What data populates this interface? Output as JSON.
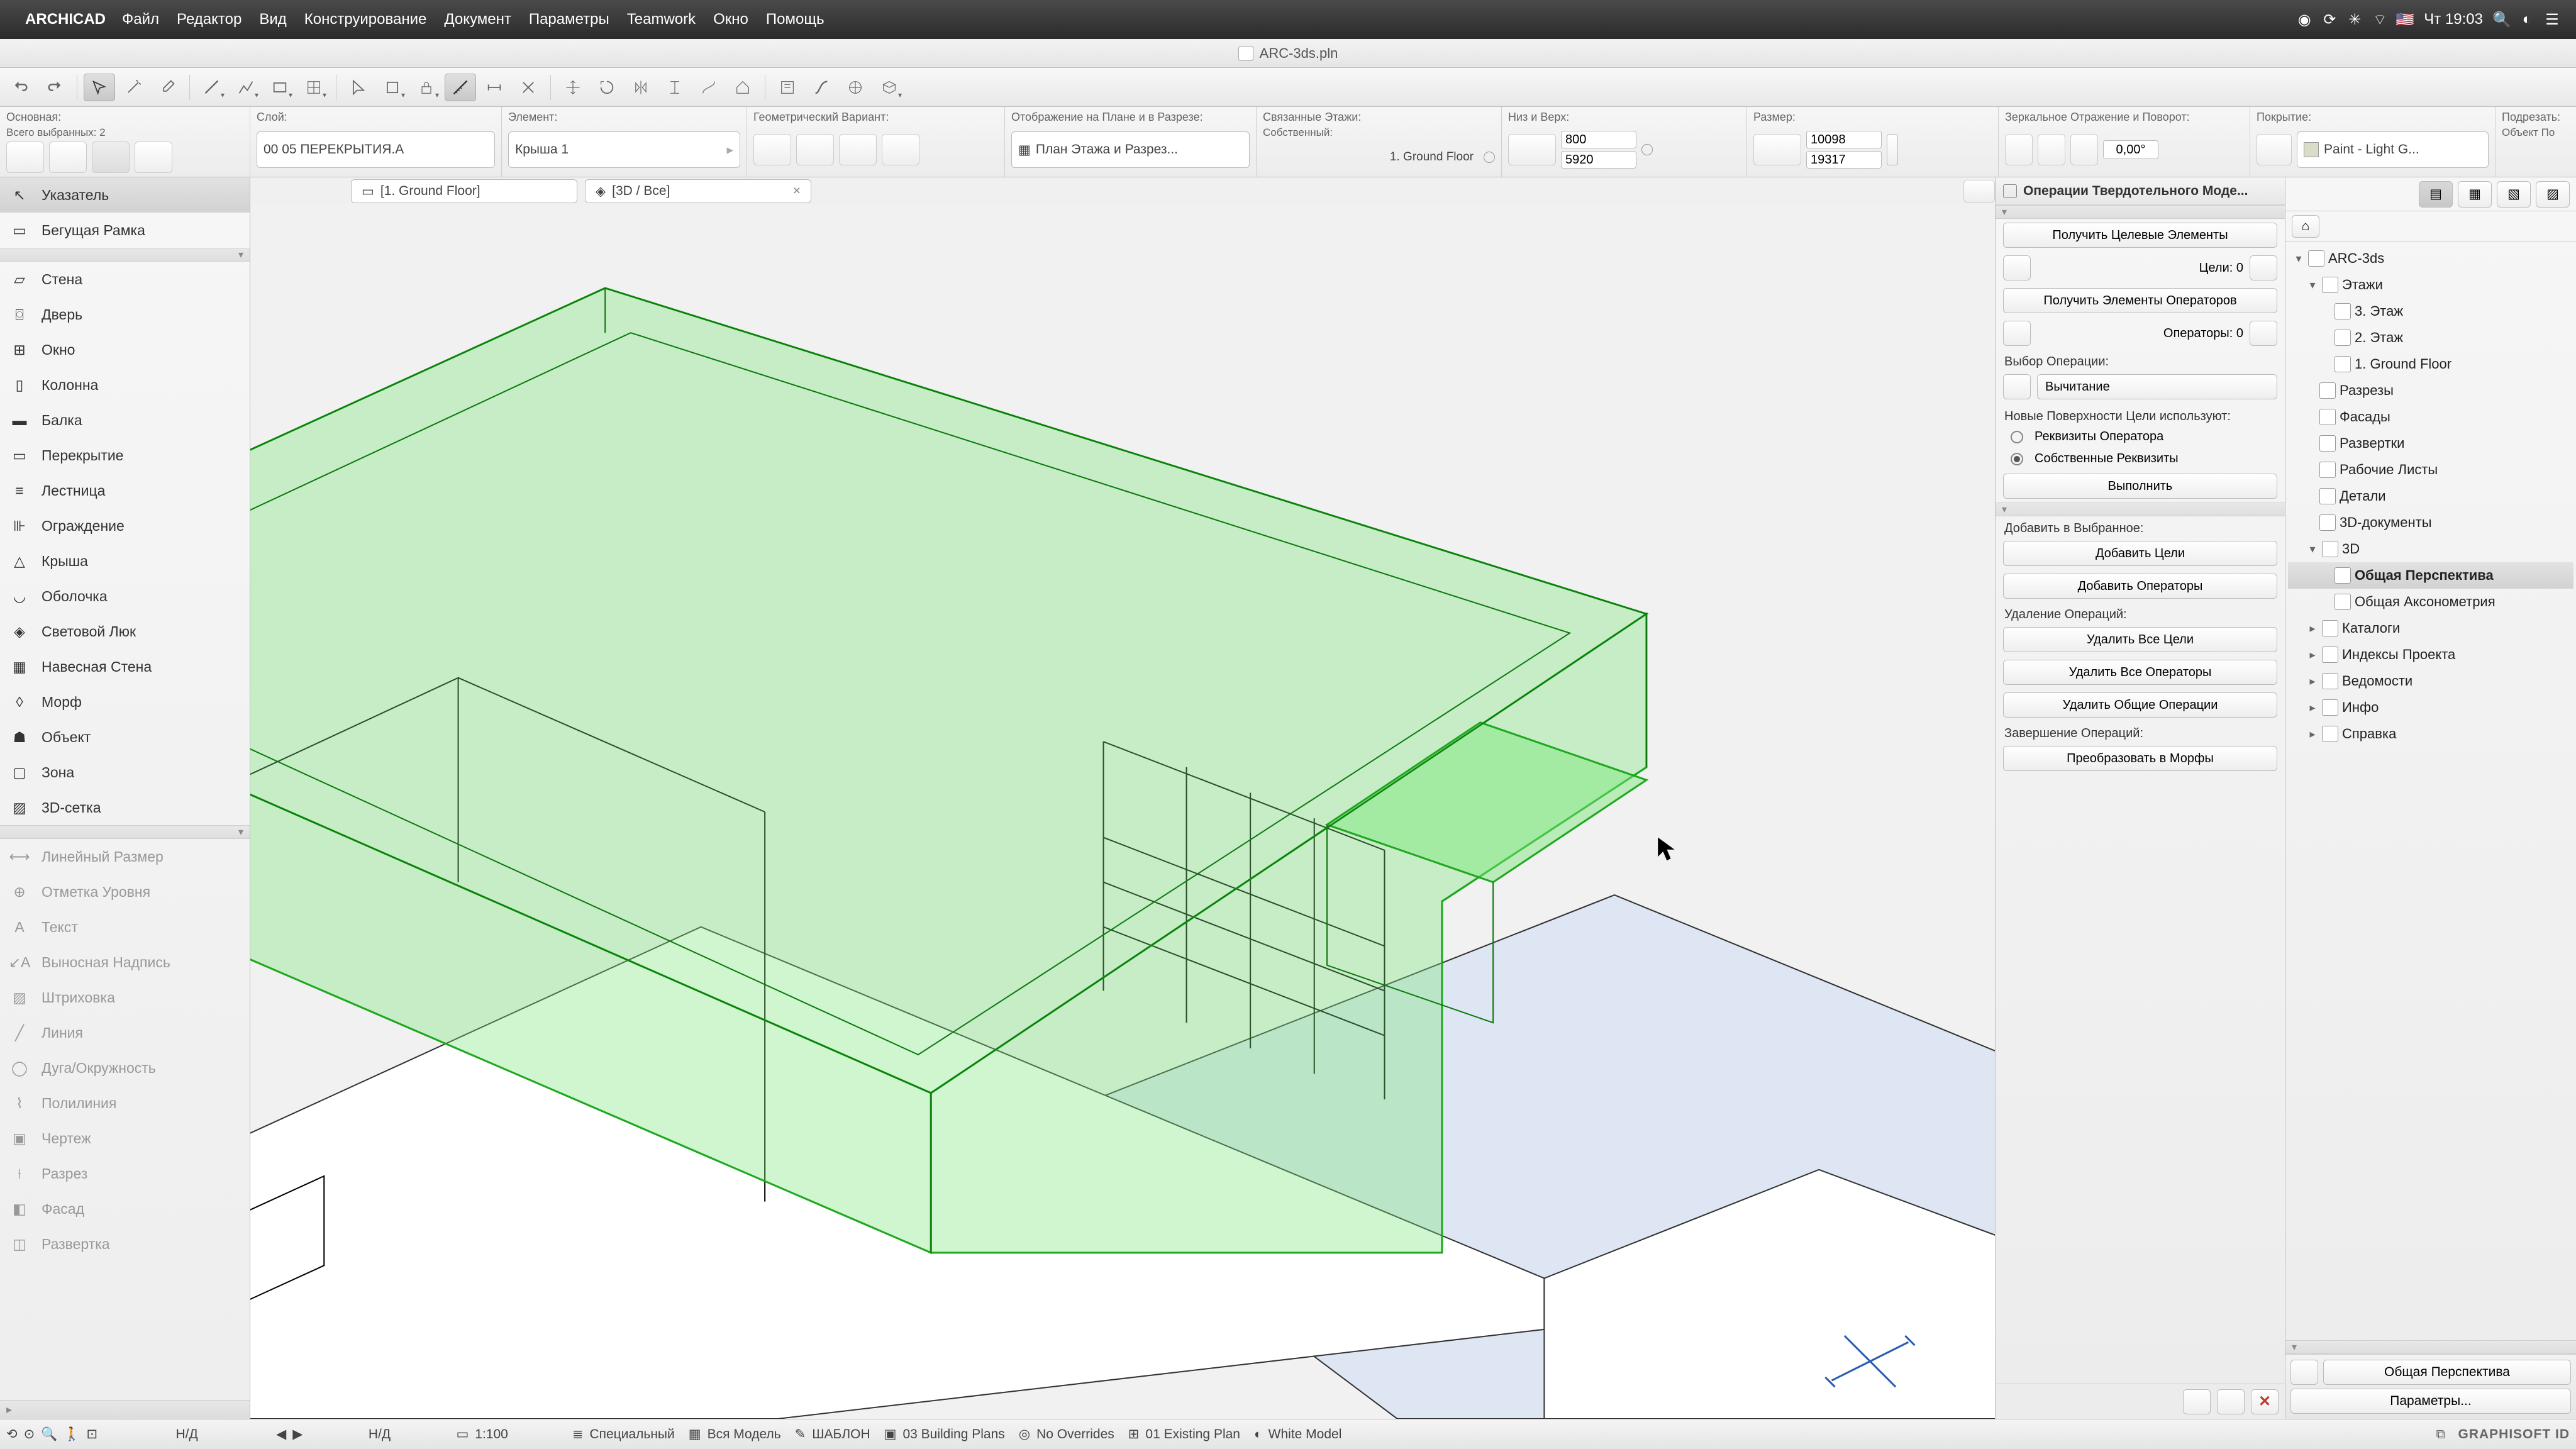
{
  "menubar": {
    "app": "ARCHICAD",
    "items": [
      "Файл",
      "Редактор",
      "Вид",
      "Конструирование",
      "Документ",
      "Параметры",
      "Teamwork",
      "Окно",
      "Помощь"
    ],
    "clock": "Чт 19:03"
  },
  "title": "ARC-3ds.pln",
  "infobar": {
    "main_lbl": "Основная:",
    "selected_lbl": "Всего выбранных: 2",
    "layer_lbl": "Слой:",
    "layer_val": "00 05 ПЕРЕКРЫТИЯ.А",
    "element_lbl": "Элемент:",
    "element_val": "Крыша 1",
    "geom_lbl": "Геометрический Вариант:",
    "display_lbl": "Отображение на Плане и в Разрезе:",
    "display_val": "План Этажа и Разрез...",
    "linked_lbl": "Связанные Этажи:",
    "linked_sub": "Собственный:",
    "linked_val": "1. Ground Floor",
    "botop_lbl": "Низ и Верх:",
    "bot": "800",
    "top": "5920",
    "size_lbl": "Размер:",
    "w": "10098",
    "h": "19317",
    "mirror_lbl": "Зеркальное Отражение и Поворот:",
    "angle": "0,00°",
    "cover_lbl": "Покрытие:",
    "cover_val": "Paint - Light G...",
    "trim_lbl": "Подрезать:",
    "trim_sub": "Объект По"
  },
  "tabs": [
    {
      "label": "[1. Ground Floor]"
    },
    {
      "label": "[3D / Все]"
    }
  ],
  "left_tools": {
    "selection": [
      "Указатель",
      "Бегущая Рамка"
    ],
    "design": [
      "Стена",
      "Дверь",
      "Окно",
      "Колонна",
      "Балка",
      "Перекрытие",
      "Лестница",
      "Ограждение",
      "Крыша",
      "Оболочка",
      "Световой Люк",
      "Навесная Стена",
      "Морф",
      "Объект",
      "Зона",
      "3D-сетка"
    ],
    "document": [
      "Линейный Размер",
      "Отметка Уровня",
      "Текст",
      "Выносная Надпись",
      "Штриховка",
      "Линия",
      "Дуга/Окружность",
      "Полилиния",
      "Чертеж",
      "Разрез",
      "Фасад",
      "Развертка"
    ]
  },
  "solid": {
    "title": "Операции Твердотельного Моде...",
    "get_targets": "Получить Целевые Элементы",
    "targets_lbl": "Цели: 0",
    "get_ops": "Получить Элементы Операторов",
    "ops_lbl": "Операторы: 0",
    "op_choice_lbl": "Выбор Операции:",
    "op_choice_val": "Вычитание",
    "surfaces_lbl": "Новые Поверхности Цели используют:",
    "r1": "Реквизиты Оператора",
    "r2": "Собственные Реквизиты",
    "execute": "Выполнить",
    "add_lbl": "Добавить в Выбранное:",
    "add_targets": "Добавить Цели",
    "add_ops": "Добавить Операторы",
    "del_lbl": "Удаление Операций:",
    "del_targets": "Удалить Все Цели",
    "del_ops": "Удалить Все Операторы",
    "del_common": "Удалить Общие Операции",
    "finish_lbl": "Завершение Операций:",
    "to_morphs": "Преобразовать в Морфы"
  },
  "nav": {
    "root": "ARC-3ds",
    "stories_lbl": "Этажи",
    "stories": [
      "3. Этаж",
      "2. Этаж",
      "1. Ground Floor"
    ],
    "folders": [
      "Разрезы",
      "Фасады",
      "Развертки",
      "Рабочие Листы",
      "Детали",
      "3D-документы"
    ],
    "d3_lbl": "3D",
    "d3": [
      "Общая Перспектива",
      "Общая Аксонометрия"
    ],
    "more": [
      "Каталоги",
      "Индексы Проекта",
      "Ведомости",
      "Инфо",
      "Справка"
    ],
    "current": "Общая Перспектива",
    "params": "Параметры..."
  },
  "status": {
    "zoom": "1:100",
    "na": "Н/Д",
    "segs": [
      "Специальный",
      "Вся Модель",
      "ШАБЛОН",
      "03 Building Plans",
      "No Overrides",
      "01 Existing Plan",
      "White Model"
    ],
    "brand": "GRAPHISOFT ID"
  }
}
